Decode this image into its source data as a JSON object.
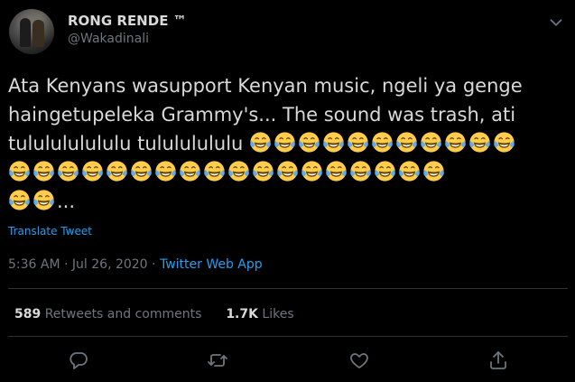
{
  "author": {
    "display_name": "RONG RENDE ™",
    "handle": "@Wakadinali"
  },
  "tweet": {
    "line1": "Ata Kenyans wasupport Kenyan music, ngeli ya genge",
    "line2": "haingetupeleka Grammy's... The sound was trash, ati",
    "line3_text": "tululululululu tulululululu",
    "line3_emoji_count": 11,
    "line4_emoji_count": 18,
    "line5_emoji_count": 2,
    "line5_suffix": "...",
    "emoji_name": "face-with-tears-of-joy"
  },
  "translate_label": "Translate Tweet",
  "meta": {
    "time": "5:36 AM",
    "separator1": " · ",
    "date": "Jul 26, 2020",
    "separator2": " · ",
    "source": "Twitter Web App"
  },
  "stats": {
    "retweets_count": "589",
    "retweets_label": "Retweets and comments",
    "likes_count": "1.7K",
    "likes_label": "Likes"
  },
  "icons": {
    "more": "chevron-down-icon",
    "reply": "reply-icon",
    "retweet": "retweet-icon",
    "like": "heart-icon",
    "share": "share-icon"
  },
  "colors": {
    "background": "#000000",
    "text": "#d9d9d9",
    "secondary": "#6e767d",
    "accent": "#1da1f2",
    "divider": "#2f3336"
  }
}
